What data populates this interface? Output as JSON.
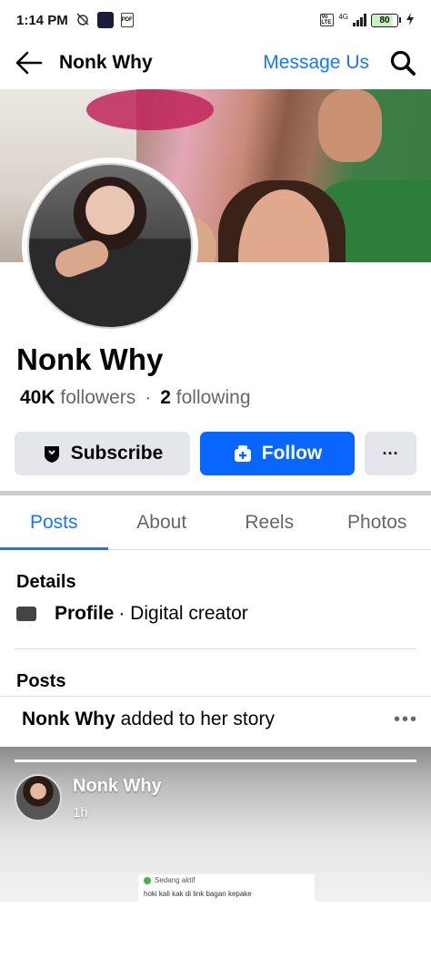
{
  "status_bar": {
    "time": "1:14 PM",
    "pdf_label": "PDF",
    "volte_label": "Vo LTE",
    "network": "4G",
    "battery": "80"
  },
  "header": {
    "title": "Nonk Why",
    "message_label": "Message Us"
  },
  "profile": {
    "name": "Nonk Why",
    "followers_count": "40K",
    "followers_label": "followers",
    "separator": "·",
    "following_count": "2",
    "following_label": "following"
  },
  "actions": {
    "subscribe_label": "Subscribe",
    "follow_label": "Follow",
    "more_label": "···"
  },
  "tabs": [
    {
      "label": "Posts",
      "active": true
    },
    {
      "label": "About",
      "active": false
    },
    {
      "label": "Reels",
      "active": false
    },
    {
      "label": "Photos",
      "active": false
    }
  ],
  "details": {
    "title": "Details",
    "profile_bold": "Profile",
    "profile_text": "· Digital creator"
  },
  "posts": {
    "title": "Posts",
    "story_author": "Nonk Why",
    "story_text": "added to her story",
    "more_label": "•••"
  },
  "story_card": {
    "name": "Nonk Why",
    "time": "1h",
    "screen_status": "Sedang aktif",
    "screen_message": "hoki kali kak di link bagan kepake"
  },
  "colors": {
    "accent": "#1877f2",
    "follow_button": "#0866ff",
    "neutral_button": "#e4e6eb"
  }
}
